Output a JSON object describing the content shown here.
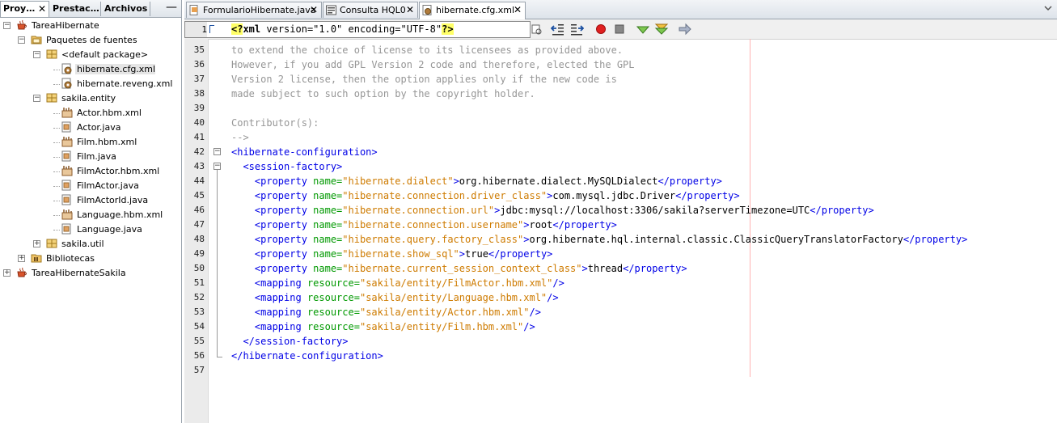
{
  "left_panel": {
    "tabs": [
      {
        "label": "Proy…",
        "closable": true,
        "active": true
      },
      {
        "label": "Prestac…",
        "closable": false,
        "active": false
      },
      {
        "label": "Archivos",
        "closable": false,
        "active": false
      }
    ],
    "minimize_label": "—",
    "tree": [
      {
        "label": "TareaHibernate",
        "icon": "coffee-project-icon",
        "depth": 0,
        "expanded": true
      },
      {
        "label": "Paquetes de fuentes",
        "icon": "source-packages-icon",
        "depth": 1,
        "expanded": true
      },
      {
        "label": "<default package>",
        "icon": "package-icon",
        "depth": 2,
        "expanded": true
      },
      {
        "label": "hibernate.cfg.xml",
        "icon": "hibernate-config-icon",
        "depth": 3,
        "selected": true
      },
      {
        "label": "hibernate.reveng.xml",
        "icon": "hibernate-config-icon",
        "depth": 3
      },
      {
        "label": "sakila.entity",
        "icon": "package-icon",
        "depth": 2,
        "expanded": true
      },
      {
        "label": "Actor.hbm.xml",
        "icon": "hibernate-mapping-icon",
        "depth": 3
      },
      {
        "label": "Actor.java",
        "icon": "java-file-icon",
        "depth": 3
      },
      {
        "label": "Film.hbm.xml",
        "icon": "hibernate-mapping-icon",
        "depth": 3
      },
      {
        "label": "Film.java",
        "icon": "java-file-icon",
        "depth": 3
      },
      {
        "label": "FilmActor.hbm.xml",
        "icon": "hibernate-mapping-icon",
        "depth": 3
      },
      {
        "label": "FilmActor.java",
        "icon": "java-file-icon",
        "depth": 3
      },
      {
        "label": "FilmActorId.java",
        "icon": "java-file-icon",
        "depth": 3
      },
      {
        "label": "Language.hbm.xml",
        "icon": "hibernate-mapping-icon",
        "depth": 3
      },
      {
        "label": "Language.java",
        "icon": "java-file-icon",
        "depth": 3
      },
      {
        "label": "sakila.util",
        "icon": "package-icon",
        "depth": 2,
        "expanded": false
      },
      {
        "label": "Bibliotecas",
        "icon": "libraries-icon",
        "depth": 1,
        "expanded": false
      },
      {
        "label": "TareaHibernateSakila",
        "icon": "coffee-project-icon",
        "depth": 0,
        "expanded": false
      }
    ]
  },
  "editor": {
    "tabs": [
      {
        "label": "FormularioHibernate.java",
        "icon": "java-file-icon",
        "active": false
      },
      {
        "label": "Consulta HQL0",
        "icon": "query-icon",
        "active": false
      },
      {
        "label": "hibernate.cfg.xml",
        "icon": "hibernate-config-icon",
        "active": true
      }
    ],
    "close_glyph": "✕",
    "line1": {
      "number": "1",
      "pi_open": "<?",
      "pi_name": "xml",
      "pi_rest": " version=\"1.0\" encoding=\"UTF-8\"",
      "pi_close": "?>"
    },
    "lines": [
      {
        "n": "35",
        "parts": [
          {
            "c": "cm",
            "t": "to extend the choice of license to its licensees as provided above."
          }
        ]
      },
      {
        "n": "36",
        "parts": [
          {
            "c": "cm",
            "t": "However, if you add GPL Version 2 code and therefore, elected the GPL"
          }
        ]
      },
      {
        "n": "37",
        "parts": [
          {
            "c": "cm",
            "t": "Version 2 license, then the option applies only if the new code is"
          }
        ]
      },
      {
        "n": "38",
        "parts": [
          {
            "c": "cm",
            "t": "made subject to such option by the copyright holder."
          }
        ]
      },
      {
        "n": "39",
        "parts": []
      },
      {
        "n": "40",
        "parts": [
          {
            "c": "cm",
            "t": "Contributor(s):"
          }
        ]
      },
      {
        "n": "41",
        "parts": [
          {
            "c": "cm",
            "t": "-->"
          }
        ]
      },
      {
        "n": "42",
        "parts": [
          {
            "c": "tag",
            "t": "<hibernate-configuration>"
          }
        ]
      },
      {
        "n": "43",
        "parts": [
          {
            "c": "tx",
            "t": "  "
          },
          {
            "c": "tag",
            "t": "<session-factory>"
          }
        ]
      },
      {
        "n": "44",
        "parts": [
          {
            "c": "tx",
            "t": "    "
          },
          {
            "c": "tag",
            "t": "<property "
          },
          {
            "c": "an",
            "t": "name="
          },
          {
            "c": "av",
            "t": "\"hibernate.dialect\""
          },
          {
            "c": "tag",
            "t": ">"
          },
          {
            "c": "tx",
            "t": "org.hibernate.dialect.MySQLDialect"
          },
          {
            "c": "tag",
            "t": "</property>"
          }
        ]
      },
      {
        "n": "45",
        "parts": [
          {
            "c": "tx",
            "t": "    "
          },
          {
            "c": "tag",
            "t": "<property "
          },
          {
            "c": "an",
            "t": "name="
          },
          {
            "c": "av",
            "t": "\"hibernate.connection.driver_class\""
          },
          {
            "c": "tag",
            "t": ">"
          },
          {
            "c": "tx",
            "t": "com.mysql.jdbc.Driver"
          },
          {
            "c": "tag",
            "t": "</property>"
          }
        ]
      },
      {
        "n": "46",
        "parts": [
          {
            "c": "tx",
            "t": "    "
          },
          {
            "c": "tag",
            "t": "<property "
          },
          {
            "c": "an",
            "t": "name="
          },
          {
            "c": "av",
            "t": "\"hibernate.connection.url\""
          },
          {
            "c": "tag",
            "t": ">"
          },
          {
            "c": "tx",
            "t": "jdbc:mysql://localhost:3306/sakila?serverTimezone=UTC"
          },
          {
            "c": "tag",
            "t": "</property>"
          }
        ]
      },
      {
        "n": "47",
        "parts": [
          {
            "c": "tx",
            "t": "    "
          },
          {
            "c": "tag",
            "t": "<property "
          },
          {
            "c": "an",
            "t": "name="
          },
          {
            "c": "av",
            "t": "\"hibernate.connection.username\""
          },
          {
            "c": "tag",
            "t": ">"
          },
          {
            "c": "tx",
            "t": "root"
          },
          {
            "c": "tag",
            "t": "</property>"
          }
        ]
      },
      {
        "n": "48",
        "parts": [
          {
            "c": "tx",
            "t": "    "
          },
          {
            "c": "tag",
            "t": "<property "
          },
          {
            "c": "an",
            "t": "name="
          },
          {
            "c": "av",
            "t": "\"hibernate.query.factory_class\""
          },
          {
            "c": "tag",
            "t": ">"
          },
          {
            "c": "tx",
            "t": "org.hibernate.hql.internal.classic.ClassicQueryTranslatorFactory"
          },
          {
            "c": "tag",
            "t": "</property>"
          }
        ]
      },
      {
        "n": "49",
        "parts": [
          {
            "c": "tx",
            "t": "    "
          },
          {
            "c": "tag",
            "t": "<property "
          },
          {
            "c": "an",
            "t": "name="
          },
          {
            "c": "av",
            "t": "\"hibernate.show_sql\""
          },
          {
            "c": "tag",
            "t": ">"
          },
          {
            "c": "tx",
            "t": "true"
          },
          {
            "c": "tag",
            "t": "</property>"
          }
        ]
      },
      {
        "n": "50",
        "parts": [
          {
            "c": "tx",
            "t": "    "
          },
          {
            "c": "tag",
            "t": "<property "
          },
          {
            "c": "an",
            "t": "name="
          },
          {
            "c": "av",
            "t": "\"hibernate.current_session_context_class\""
          },
          {
            "c": "tag",
            "t": ">"
          },
          {
            "c": "tx",
            "t": "thread"
          },
          {
            "c": "tag",
            "t": "</property>"
          }
        ]
      },
      {
        "n": "51",
        "parts": [
          {
            "c": "tx",
            "t": "    "
          },
          {
            "c": "tag",
            "t": "<mapping "
          },
          {
            "c": "an",
            "t": "resource="
          },
          {
            "c": "av",
            "t": "\"sakila/entity/FilmActor.hbm.xml\""
          },
          {
            "c": "tag",
            "t": "/>"
          }
        ]
      },
      {
        "n": "52",
        "parts": [
          {
            "c": "tx",
            "t": "    "
          },
          {
            "c": "tag",
            "t": "<mapping "
          },
          {
            "c": "an",
            "t": "resource="
          },
          {
            "c": "av",
            "t": "\"sakila/entity/Language.hbm.xml\""
          },
          {
            "c": "tag",
            "t": "/>"
          }
        ]
      },
      {
        "n": "53",
        "parts": [
          {
            "c": "tx",
            "t": "    "
          },
          {
            "c": "tag",
            "t": "<mapping "
          },
          {
            "c": "an",
            "t": "resource="
          },
          {
            "c": "av",
            "t": "\"sakila/entity/Actor.hbm.xml\""
          },
          {
            "c": "tag",
            "t": "/>"
          }
        ]
      },
      {
        "n": "54",
        "parts": [
          {
            "c": "tx",
            "t": "    "
          },
          {
            "c": "tag",
            "t": "<mapping "
          },
          {
            "c": "an",
            "t": "resource="
          },
          {
            "c": "av",
            "t": "\"sakila/entity/Film.hbm.xml\""
          },
          {
            "c": "tag",
            "t": "/>"
          }
        ]
      },
      {
        "n": "55",
        "parts": [
          {
            "c": "tx",
            "t": "  "
          },
          {
            "c": "tag",
            "t": "</session-factory>"
          }
        ]
      },
      {
        "n": "56",
        "parts": [
          {
            "c": "tag",
            "t": "</hibernate-configuration>"
          }
        ]
      },
      {
        "n": "57",
        "parts": []
      }
    ]
  },
  "colors": {
    "tag": "#0000e6",
    "attr_name": "#009900",
    "attr_value": "#ce7b00",
    "comment": "#969696",
    "pi_highlight": "#ffff66",
    "margin": "#ffb3b3"
  }
}
